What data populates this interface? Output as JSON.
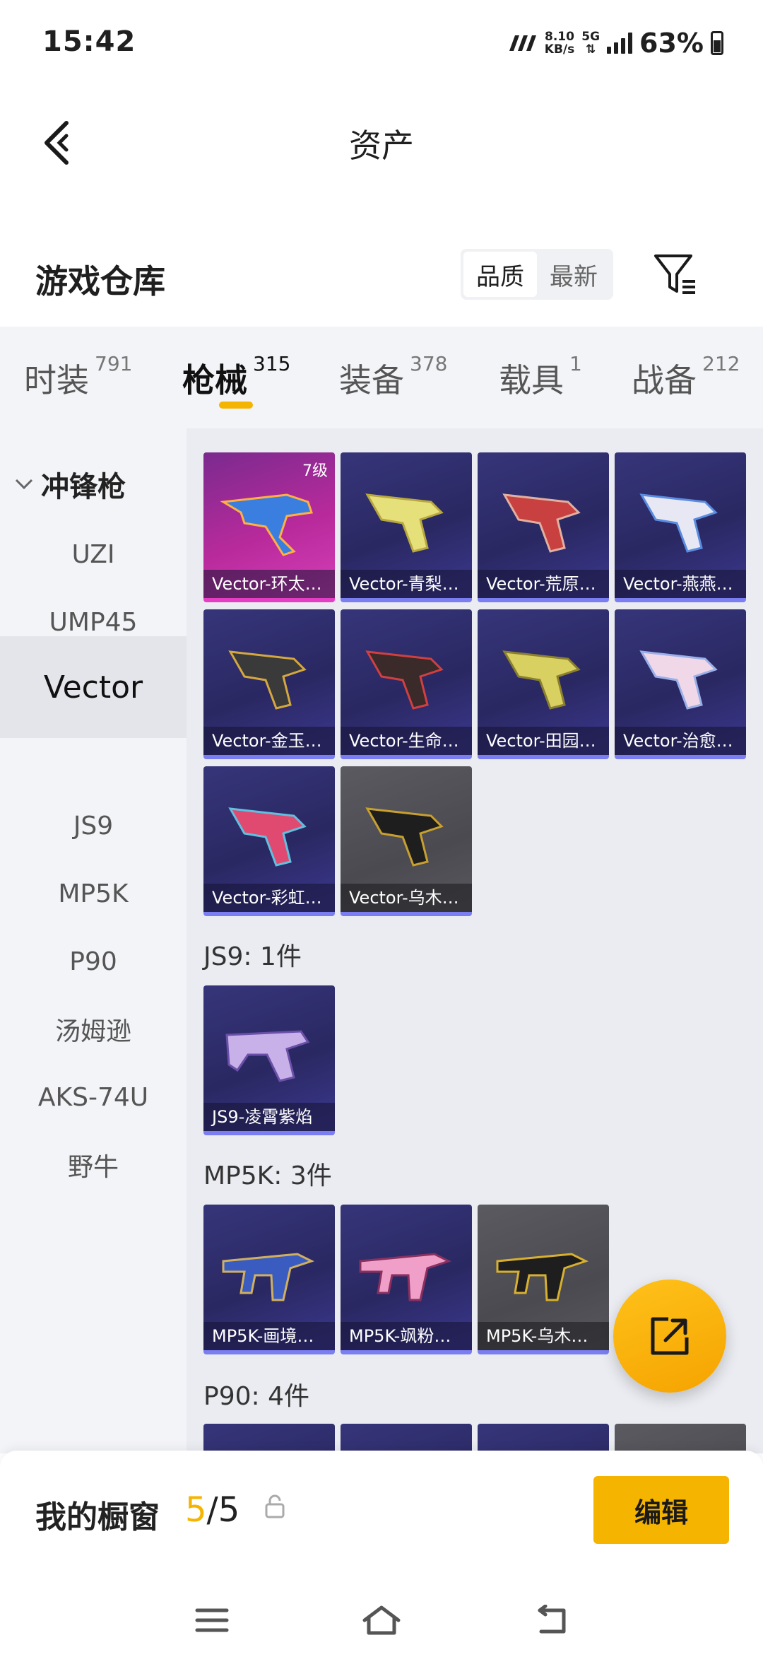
{
  "status_bar": {
    "time": "15:42",
    "net_speed": "8.10",
    "net_unit": "KB/s",
    "network": "5G",
    "battery": "63%"
  },
  "header": {
    "title": "资产"
  },
  "warehouse": {
    "title": "游戏仓库",
    "sort_options": [
      "品质",
      "最新"
    ],
    "sort_active": "品质"
  },
  "tabs": [
    {
      "label": "时装",
      "count": "791"
    },
    {
      "label": "枪械",
      "count": "315"
    },
    {
      "label": "装备",
      "count": "378"
    },
    {
      "label": "载具",
      "count": "1"
    },
    {
      "label": "战备",
      "count": "212"
    }
  ],
  "active_tab": "枪械",
  "sidebar": {
    "group": "冲锋枪",
    "items": [
      "UZI",
      "UMP45",
      "Vector",
      "JS9",
      "MP5K",
      "P90",
      "汤姆逊",
      "AKS-74U",
      "野牛"
    ],
    "active": "Vector"
  },
  "sections": {
    "vector": {
      "cards": [
        {
          "name": "Vector-环太…",
          "level": "7级",
          "style": "pink"
        },
        {
          "name": "Vector-青梨…",
          "style": "purple"
        },
        {
          "name": "Vector-荒原…",
          "style": "purple"
        },
        {
          "name": "Vector-燕燕…",
          "style": "purple"
        },
        {
          "name": "Vector-金玉…",
          "style": "purple"
        },
        {
          "name": "Vector-生命…",
          "style": "purple"
        },
        {
          "name": "Vector-田园…",
          "style": "purple"
        },
        {
          "name": "Vector-治愈…",
          "style": "purple"
        },
        {
          "name": "Vector-彩虹…",
          "style": "purple"
        },
        {
          "name": "Vector-乌木…",
          "style": "grey"
        }
      ]
    },
    "js9": {
      "label": "JS9: 1件",
      "cards": [
        {
          "name": "JS9-凌霄紫焰",
          "style": "purple"
        }
      ]
    },
    "mp5k": {
      "label": "MP5K: 3件",
      "cards": [
        {
          "name": "MP5K-画境…",
          "style": "purple"
        },
        {
          "name": "MP5K-飒粉…",
          "style": "purple"
        },
        {
          "name": "MP5K-乌木…",
          "style": "grey"
        }
      ]
    },
    "p90": {
      "label": "P90: 4件"
    }
  },
  "showcase": {
    "title": "我的橱窗",
    "count_current": "5",
    "count_sep": "/",
    "count_total": "5",
    "edit_label": "编辑"
  },
  "colors": {
    "accent": "#f5b400",
    "card_purple": "#2f2d70",
    "card_pink": "#b82a9c",
    "card_grey": "#505056"
  }
}
